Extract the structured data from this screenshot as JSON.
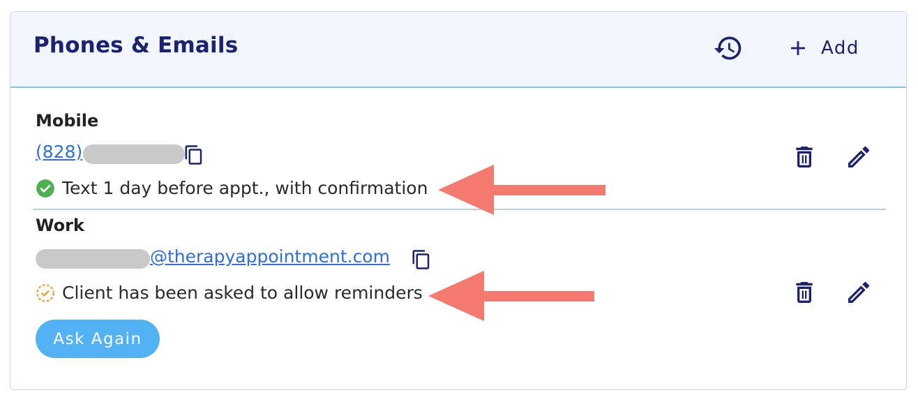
{
  "card": {
    "title": "Phones & Emails",
    "add_label": "Add",
    "icons": {
      "history": "history-icon",
      "add": "plus-icon"
    }
  },
  "entries": [
    {
      "type": "Mobile",
      "value_prefix": "(828)",
      "value_suffix": "",
      "status_text": "Text 1 day before appt., with confirmation",
      "status_icon": "check-circle-icon",
      "status_color": "#4caf50"
    },
    {
      "type": "Work",
      "value_prefix": "",
      "value_suffix": "@therapyappointment.com",
      "status_text": "Client has been asked to allow reminders",
      "status_icon": "pending-circle-icon",
      "status_color": "#f0a23a",
      "action_button": "Ask Again"
    }
  ],
  "colors": {
    "title": "#1c2272",
    "link": "#2f6fdd",
    "header_bg": "#f1f6fd",
    "button_bg": "#53b2f4",
    "annotation_arrow": "#f47a6f"
  }
}
